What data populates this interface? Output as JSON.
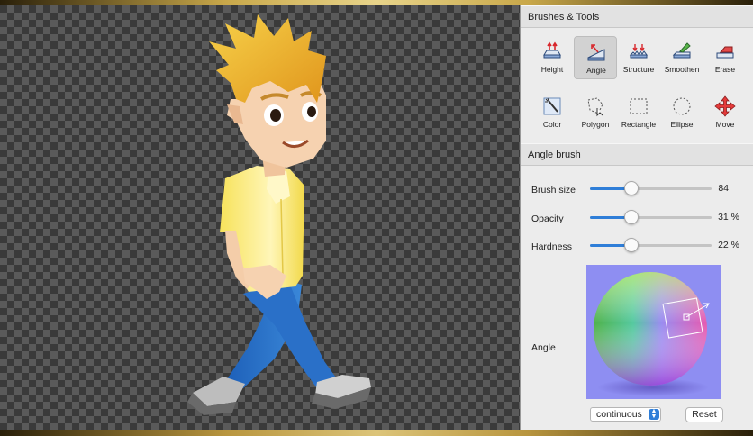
{
  "panel": {
    "tools_header": "Brushes & Tools",
    "brush_header": "Angle brush",
    "tools_row1": [
      {
        "label": "Height",
        "icon": "height-brush-icon"
      },
      {
        "label": "Angle",
        "icon": "angle-brush-icon",
        "selected": true
      },
      {
        "label": "Structure",
        "icon": "structure-brush-icon"
      },
      {
        "label": "Smoothen",
        "icon": "smoothen-brush-icon"
      },
      {
        "label": "Erase",
        "icon": "erase-brush-icon"
      }
    ],
    "tools_row2": [
      {
        "label": "Color",
        "icon": "color-wand-icon"
      },
      {
        "label": "Polygon",
        "icon": "polygon-select-icon"
      },
      {
        "label": "Rectangle",
        "icon": "rectangle-select-icon"
      },
      {
        "label": "Ellipse",
        "icon": "ellipse-select-icon"
      },
      {
        "label": "Move",
        "icon": "move-icon"
      }
    ],
    "brush_size": {
      "label": "Brush size",
      "value": "84",
      "fraction": 0.34
    },
    "opacity": {
      "label": "Opacity",
      "value": "31 %",
      "fraction": 0.34
    },
    "hardness": {
      "label": "Hardness",
      "value": "22 %",
      "fraction": 0.34
    },
    "angle_label": "Angle",
    "mode_select": "continuous",
    "reset_label": "Reset"
  },
  "colors": {
    "accent": "#2f7ed8",
    "picker_bg": "#8e8ef2",
    "arrow_red": "#d8262b"
  }
}
